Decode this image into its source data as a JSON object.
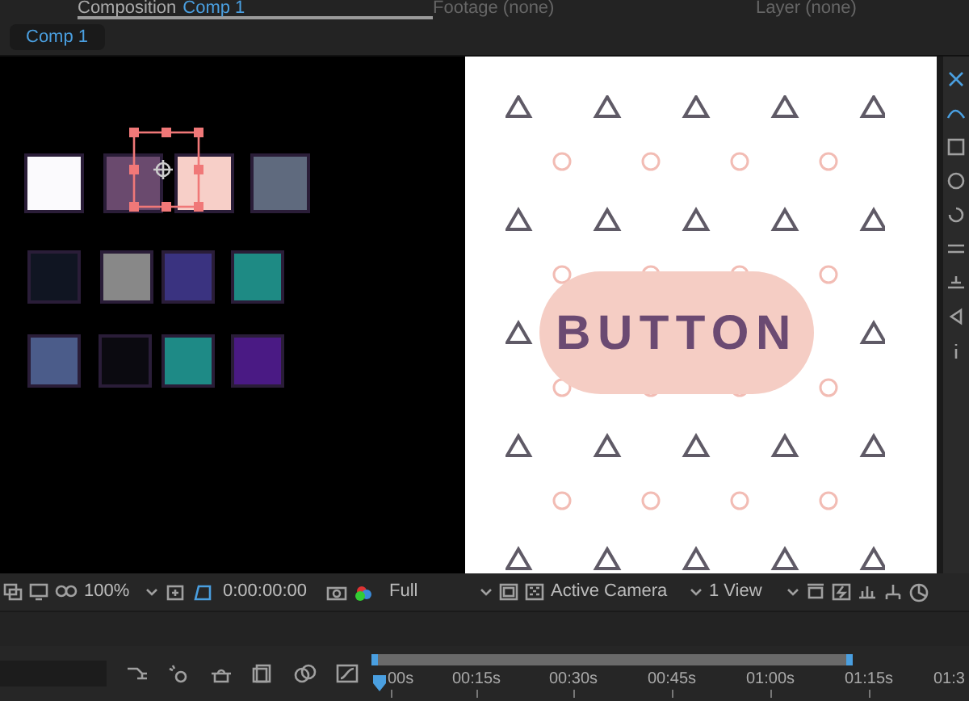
{
  "panel_tabs": [
    {
      "label": "Composition",
      "comp_name": "Comp 1",
      "selected": true
    },
    {
      "label": "Footage (none)",
      "selected": false
    },
    {
      "label": "Layer (none)",
      "selected": false
    }
  ],
  "comp_chip": "Comp 1",
  "swatches": [
    {
      "color": "#fbfafd"
    },
    {
      "color": "#6a4a6e"
    },
    {
      "color": "#f7cfc8"
    },
    {
      "color": "#5f6a7e"
    },
    {
      "color": "#101522"
    },
    {
      "color": "#888888"
    },
    {
      "color": "#3a3380"
    },
    {
      "color": "#1e8a84"
    },
    {
      "color": "#4b5c8a"
    },
    {
      "color": "#0b0a10"
    },
    {
      "color": "#1e8a86"
    },
    {
      "color": "#4a1a84"
    }
  ],
  "canvas": {
    "button_label": "BUTTON"
  },
  "toolbar": {
    "zoom": "100%",
    "timecode": "0:00:00:00",
    "resolution": "Full",
    "camera": "Active Camera",
    "views": "1 View"
  },
  "timeline": {
    "ruler": [
      "00s",
      "00:15s",
      "00:30s",
      "00:45s",
      "01:00s",
      "01:15s",
      "01:3"
    ]
  }
}
